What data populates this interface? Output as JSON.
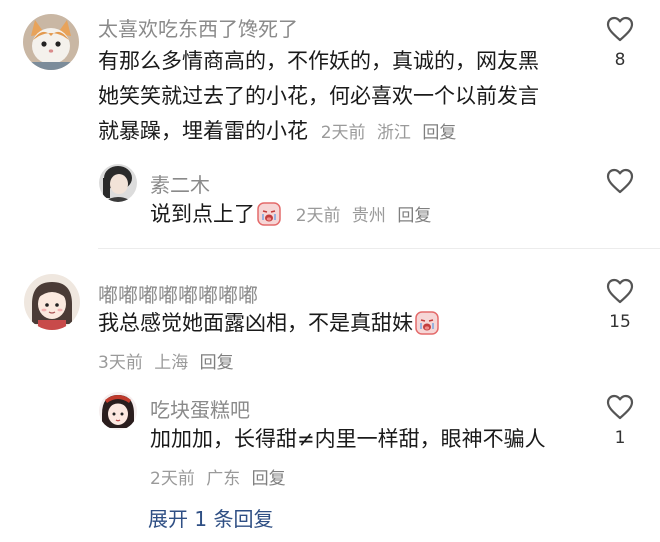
{
  "comments": [
    {
      "user": "太喜欢吃东西了馋死了",
      "text_lines": [
        "有那么多情商高的，不作妖的，真诚的，网友黑",
        "她笑笑就过去了的小花，何必喜欢一个以前发言",
        "就暴躁，埋着雷的小花"
      ],
      "time": "2天前",
      "location": "浙江",
      "reply_label": "回复",
      "likes": "8",
      "avatar_icon": "cat-avatar-icon",
      "replies": [
        {
          "user": "素二木",
          "text": "说到点上了",
          "emoji": "crying-emoji-icon",
          "time": "2天前",
          "location": "贵州",
          "reply_label": "回复",
          "likes": "",
          "avatar_icon": "girl-avatar-icon"
        }
      ]
    },
    {
      "user": "嘟嘟嘟嘟嘟嘟嘟嘟",
      "text": "我总感觉她面露凶相，不是真甜妹",
      "emoji": "crying-emoji-icon",
      "time": "3天前",
      "location": "上海",
      "reply_label": "回复",
      "likes": "15",
      "avatar_icon": "cartoon-avatar-icon",
      "replies": [
        {
          "user": "吃块蛋糕吧",
          "text": "加加加，长得甜≠内里一样甜，眼神不骗人",
          "time": "2天前",
          "location": "广东",
          "reply_label": "回复",
          "likes": "1",
          "avatar_icon": "anime-avatar-icon"
        }
      ]
    }
  ],
  "expand_label": "展开 1 条回复",
  "colors": {
    "username": "#8a8a8a",
    "meta": "#9a9a9a",
    "link": "#2f4f84",
    "text": "#1a1a1a"
  }
}
